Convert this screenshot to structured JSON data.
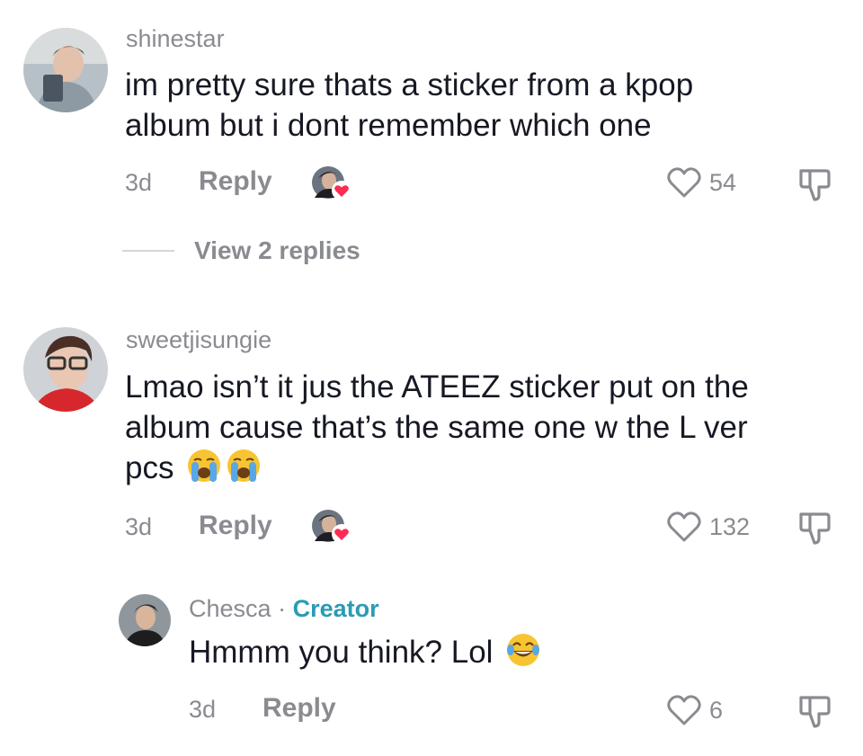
{
  "comments": [
    {
      "username": "shinestar",
      "text_line1": "im pretty sure thats a sticker from a kpop",
      "text_line2": "album but i dont remember which one",
      "time": "3d",
      "reply_label": "Reply",
      "likes": "54",
      "view_replies": "View 2 replies"
    },
    {
      "username": "sweetjisungie",
      "text_line1": "Lmao isn’t it jus the ATEEZ sticker put on the",
      "text_line2": "album cause that’s the same one w the L ver",
      "text_line3": "pcs",
      "time": "3d",
      "reply_label": "Reply",
      "likes": "132"
    }
  ],
  "reply": {
    "username": "Chesca",
    "separator": "·",
    "badge": "Creator",
    "text": "Hmmm you think? Lol",
    "time": "3d",
    "reply_label": "Reply",
    "likes": "6"
  },
  "colors": {
    "text_primary": "#161823",
    "text_secondary": "#8a8b91",
    "creator": "#2b9bb5",
    "heart_badge": "#fe2c55"
  },
  "icons": [
    "heart-outline-icon",
    "thumbs-down-icon",
    "heart-badge-icon",
    "loudly-crying-face-emoji",
    "tears-of-joy-emoji"
  ]
}
